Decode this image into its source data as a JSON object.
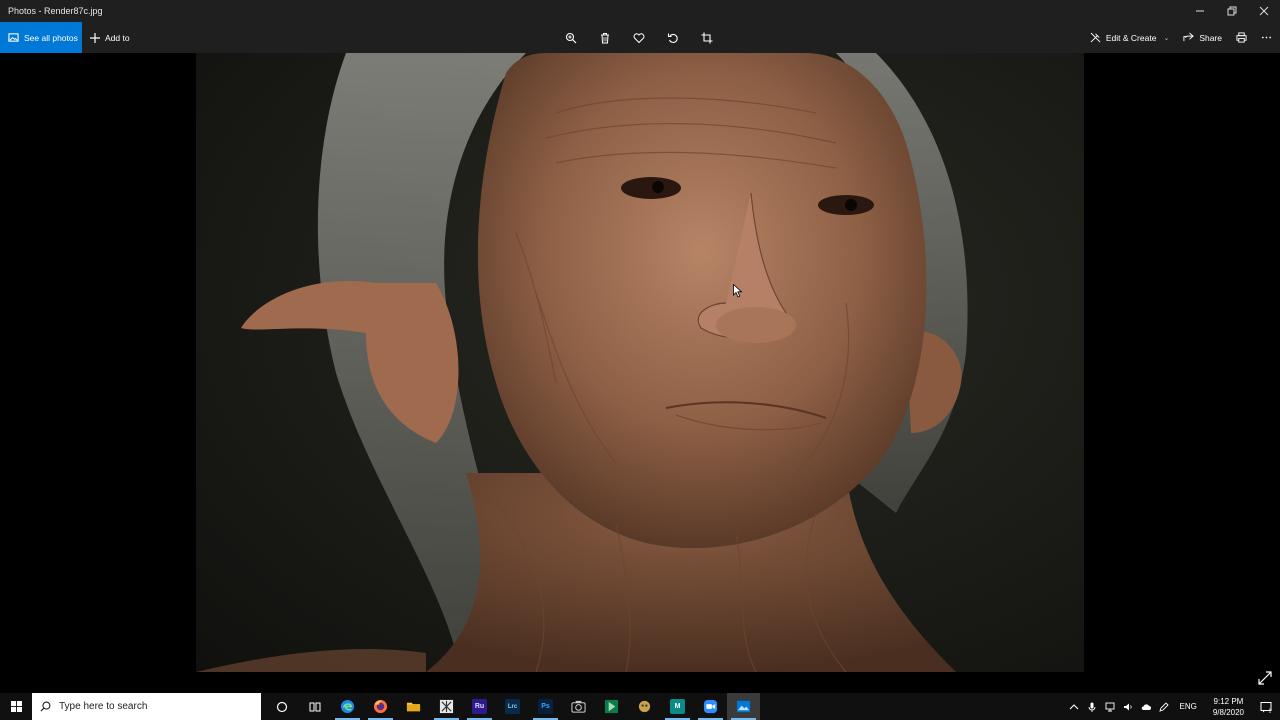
{
  "window": {
    "title": "Photos - Render87c.jpg"
  },
  "toolbar": {
    "see_all_label": "See all photos",
    "add_to_label": "Add to",
    "edit_create_label": "Edit & Create",
    "share_label": "Share"
  },
  "taskbar": {
    "search_placeholder": "Type here to search",
    "apps": [
      {
        "name": "Cortana",
        "icon": "circle-icon"
      },
      {
        "name": "Task View",
        "icon": "task-view-icon"
      },
      {
        "name": "Edge",
        "icon": "edge-icon"
      },
      {
        "name": "Firefox",
        "icon": "firefox-icon"
      },
      {
        "name": "File Explorer",
        "icon": "folder-icon"
      },
      {
        "name": "ZBrush",
        "icon": "zbrush-icon"
      },
      {
        "name": "Rush",
        "label": "Ru",
        "color": "#2d1b8a"
      },
      {
        "name": "Lightroom Classic",
        "label": "Lrc",
        "color": "#0a2a4a"
      },
      {
        "name": "Photoshop",
        "label": "Ps",
        "color": "#0a1f3c"
      },
      {
        "name": "Camera",
        "icon": "camera-icon"
      },
      {
        "name": "Video app",
        "icon": "video-icon"
      },
      {
        "name": "Marmoset",
        "icon": "marmoset-icon"
      },
      {
        "name": "Mudbox",
        "label": "M",
        "color": "#0c8a8a"
      },
      {
        "name": "Zoom",
        "icon": "zoom-icon"
      },
      {
        "name": "Photos",
        "icon": "photos-icon"
      }
    ],
    "language": "ENG",
    "time": "9:12 PM",
    "date": "9/8/2020",
    "notification_count": "1"
  },
  "colors": {
    "accent": "#0078d7",
    "titlebar": "#1f1f1f",
    "taskbar": "#101010"
  }
}
